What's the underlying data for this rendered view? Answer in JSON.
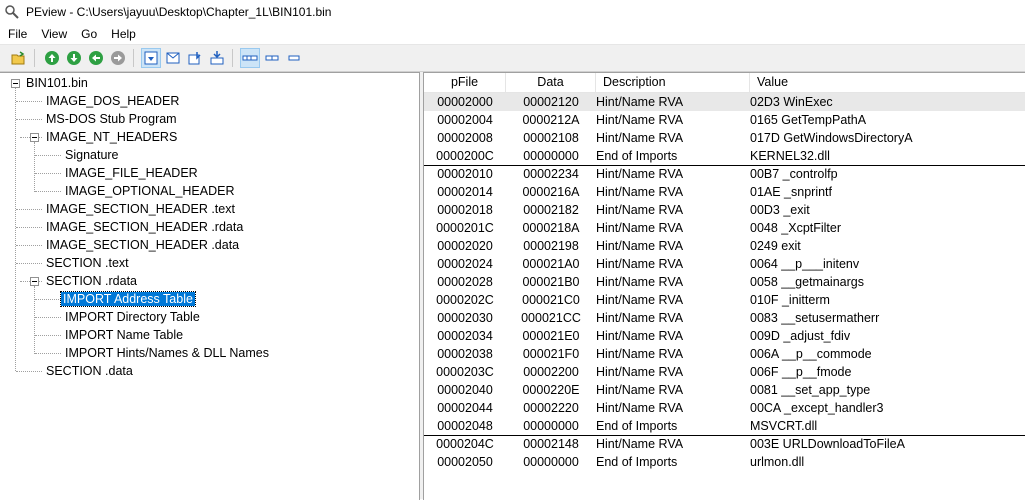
{
  "window": {
    "title": "PEview - C:\\Users\\jayuu\\Desktop\\Chapter_1L\\BIN101.bin"
  },
  "menu": [
    "File",
    "View",
    "Go",
    "Help"
  ],
  "toolbar": {
    "buttons": [
      "open-file-icon",
      "go-up-icon",
      "go-down-icon",
      "go-back-icon",
      "go-forward-icon",
      "view-byte-icon",
      "view-word-icon",
      "view-dword-icon",
      "view-qword-icon",
      "address-mode-1-icon",
      "address-mode-2-icon",
      "address-mode-3-icon"
    ]
  },
  "tree": {
    "items": [
      "BIN101.bin",
      "IMAGE_DOS_HEADER",
      "MS-DOS Stub Program",
      "IMAGE_NT_HEADERS",
      "Signature",
      "IMAGE_FILE_HEADER",
      "IMAGE_OPTIONAL_HEADER",
      "IMAGE_SECTION_HEADER .text",
      "IMAGE_SECTION_HEADER .rdata",
      "IMAGE_SECTION_HEADER .data",
      "SECTION .text",
      "SECTION .rdata",
      "IMPORT Address Table",
      "IMPORT Directory Table",
      "IMPORT Name Table",
      "IMPORT Hints/Names & DLL Names",
      "SECTION .data"
    ],
    "selected": "IMPORT Address Table"
  },
  "list": {
    "columns": [
      "pFile",
      "Data",
      "Description",
      "Value"
    ],
    "rows": [
      {
        "pfile": "00002000",
        "data": "00002120",
        "desc": "Hint/Name RVA",
        "value": "02D3  WinExec"
      },
      {
        "pfile": "00002004",
        "data": "0000212A",
        "desc": "Hint/Name RVA",
        "value": "0165  GetTempPathA"
      },
      {
        "pfile": "00002008",
        "data": "00002108",
        "desc": "Hint/Name RVA",
        "value": "017D  GetWindowsDirectoryA"
      },
      {
        "pfile": "0000200C",
        "data": "00000000",
        "desc": "End of Imports",
        "value": "KERNEL32.dll"
      },
      {
        "pfile": "00002010",
        "data": "00002234",
        "desc": "Hint/Name RVA",
        "value": "00B7  _controlfp"
      },
      {
        "pfile": "00002014",
        "data": "0000216A",
        "desc": "Hint/Name RVA",
        "value": "01AE  _snprintf"
      },
      {
        "pfile": "00002018",
        "data": "00002182",
        "desc": "Hint/Name RVA",
        "value": "00D3  _exit"
      },
      {
        "pfile": "0000201C",
        "data": "0000218A",
        "desc": "Hint/Name RVA",
        "value": "0048  _XcptFilter"
      },
      {
        "pfile": "00002020",
        "data": "00002198",
        "desc": "Hint/Name RVA",
        "value": "0249  exit"
      },
      {
        "pfile": "00002024",
        "data": "000021A0",
        "desc": "Hint/Name RVA",
        "value": "0064  __p___initenv"
      },
      {
        "pfile": "00002028",
        "data": "000021B0",
        "desc": "Hint/Name RVA",
        "value": "0058  __getmainargs"
      },
      {
        "pfile": "0000202C",
        "data": "000021C0",
        "desc": "Hint/Name RVA",
        "value": "010F  _initterm"
      },
      {
        "pfile": "00002030",
        "data": "000021CC",
        "desc": "Hint/Name RVA",
        "value": "0083  __setusermatherr"
      },
      {
        "pfile": "00002034",
        "data": "000021E0",
        "desc": "Hint/Name RVA",
        "value": "009D  _adjust_fdiv"
      },
      {
        "pfile": "00002038",
        "data": "000021F0",
        "desc": "Hint/Name RVA",
        "value": "006A  __p__commode"
      },
      {
        "pfile": "0000203C",
        "data": "00002200",
        "desc": "Hint/Name RVA",
        "value": "006F  __p__fmode"
      },
      {
        "pfile": "00002040",
        "data": "0000220E",
        "desc": "Hint/Name RVA",
        "value": "0081  __set_app_type"
      },
      {
        "pfile": "00002044",
        "data": "00002220",
        "desc": "Hint/Name RVA",
        "value": "00CA  _except_handler3"
      },
      {
        "pfile": "00002048",
        "data": "00000000",
        "desc": "End of Imports",
        "value": "MSVCRT.dll"
      },
      {
        "pfile": "0000204C",
        "data": "00002148",
        "desc": "Hint/Name RVA",
        "value": "003E  URLDownloadToFileA"
      },
      {
        "pfile": "00002050",
        "data": "00000000",
        "desc": "End of Imports",
        "value": "urlmon.dll"
      }
    ]
  }
}
